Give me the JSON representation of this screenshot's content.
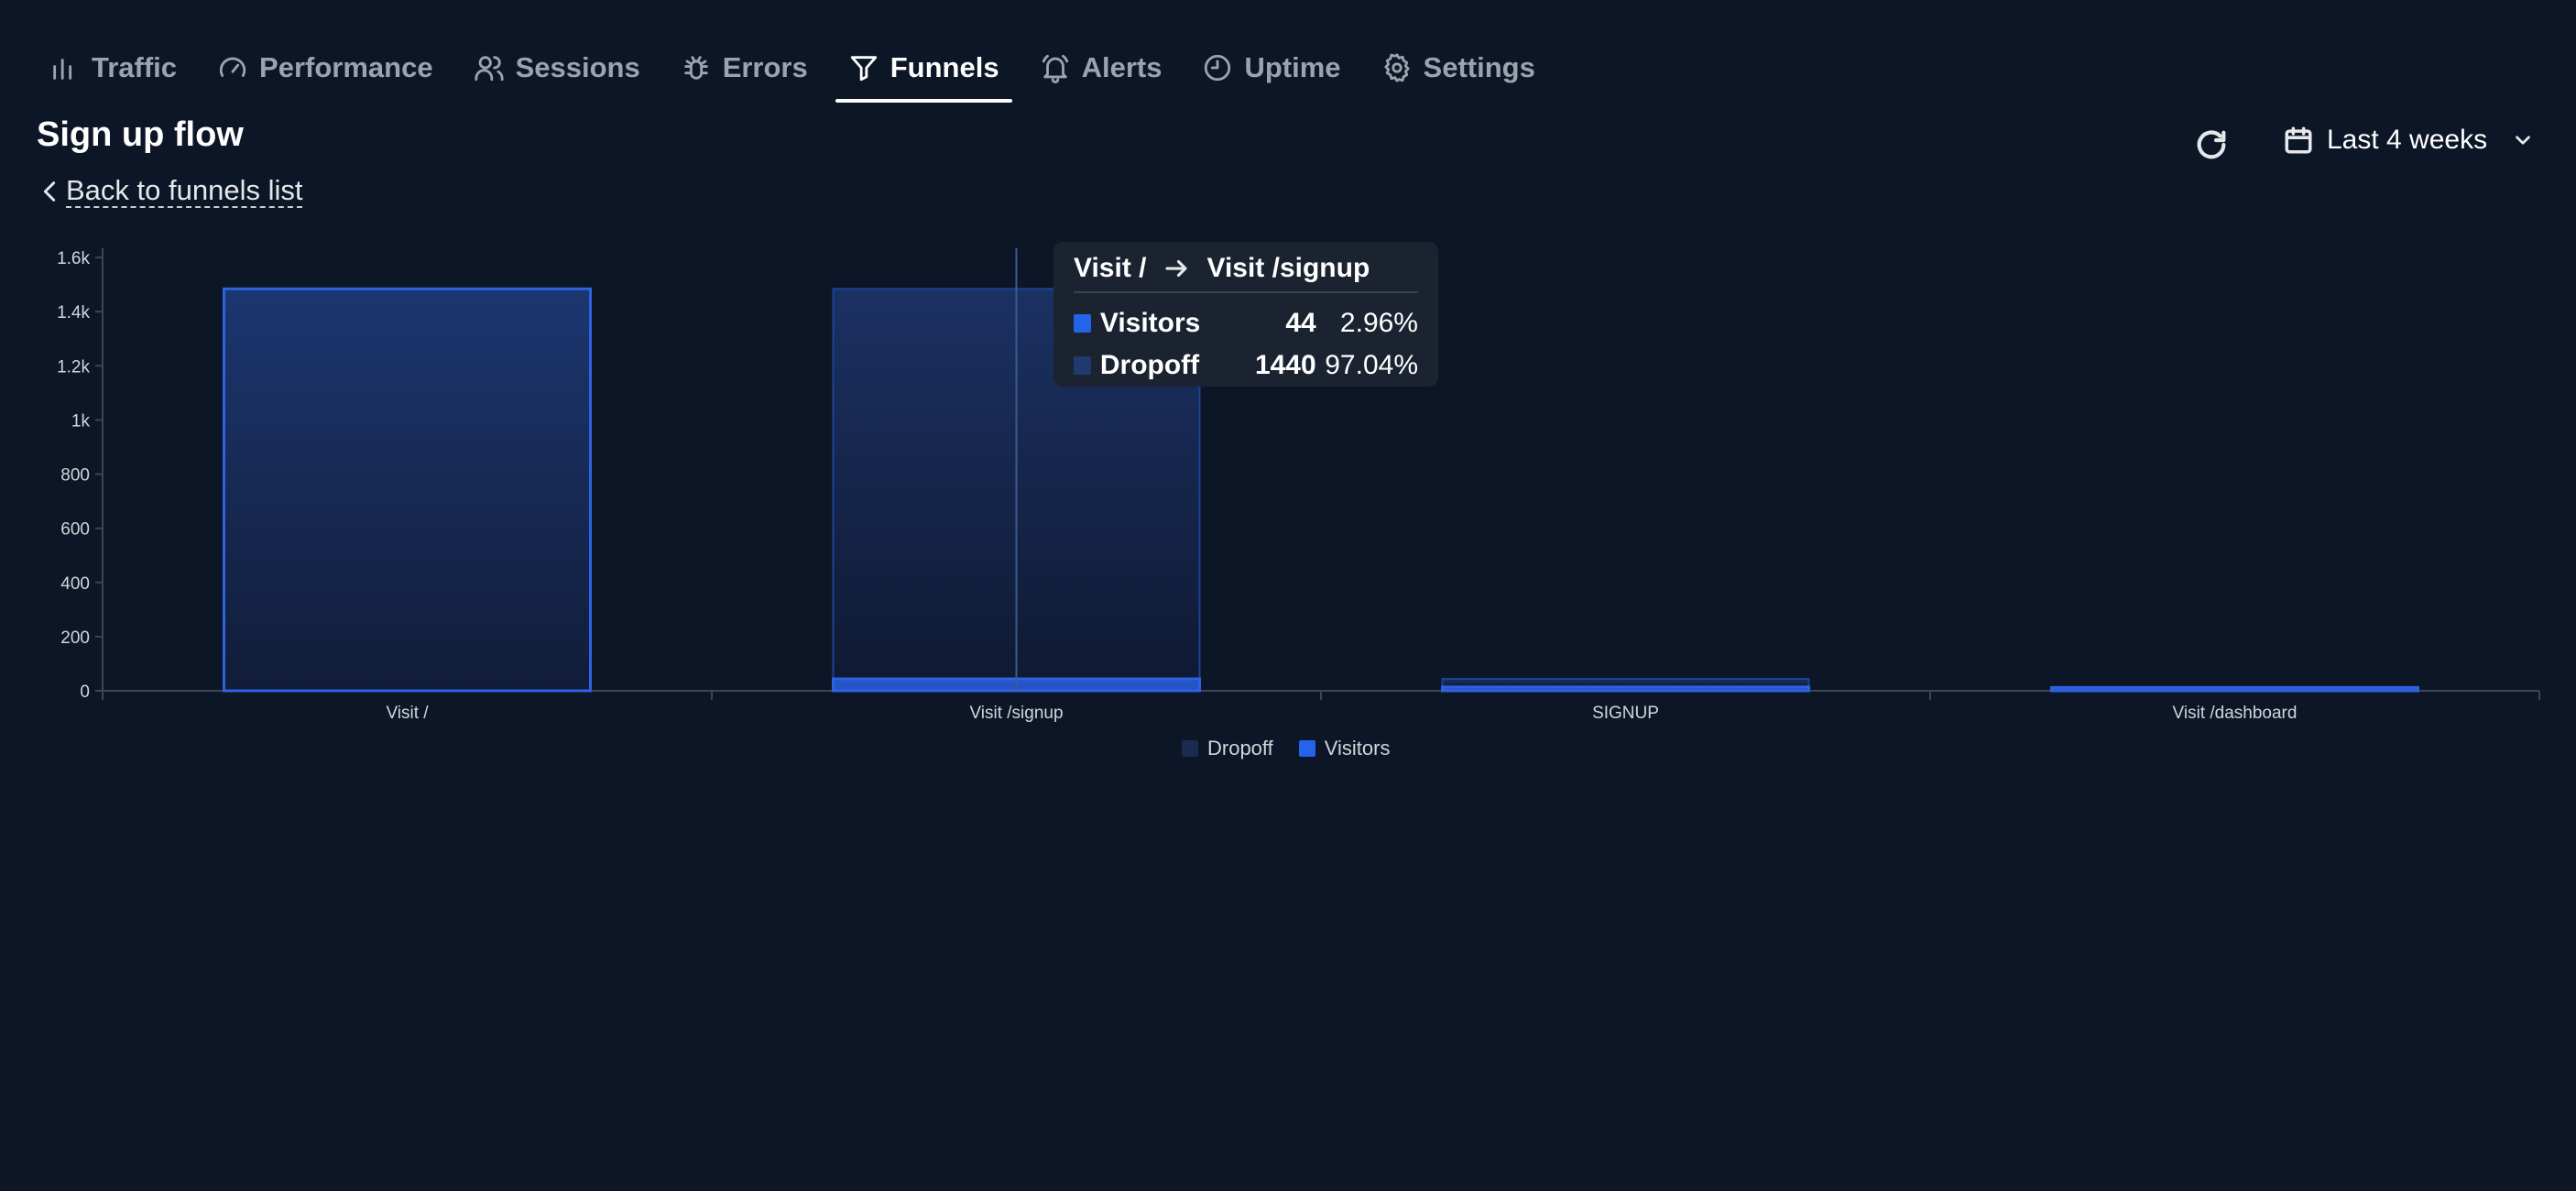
{
  "nav": {
    "items": [
      {
        "label": "Traffic",
        "icon": "bar-chart-icon"
      },
      {
        "label": "Performance",
        "icon": "gauge-icon"
      },
      {
        "label": "Sessions",
        "icon": "users-icon"
      },
      {
        "label": "Errors",
        "icon": "bug-icon"
      },
      {
        "label": "Funnels",
        "icon": "filter-icon",
        "active": true
      },
      {
        "label": "Alerts",
        "icon": "bell-icon"
      },
      {
        "label": "Uptime",
        "icon": "clock-icon"
      },
      {
        "label": "Settings",
        "icon": "gear-icon"
      }
    ]
  },
  "page": {
    "title": "Sign up flow",
    "back_label": "Back to funnels list"
  },
  "toolbar": {
    "range_label": "Last 4 weeks",
    "refresh_icon": "refresh-icon",
    "calendar_icon": "calendar-icon"
  },
  "tooltip": {
    "from": "Visit /",
    "to": "Visit /signup",
    "rows": [
      {
        "name": "Visitors",
        "count": "44",
        "pct": "2.96%",
        "color": "#2563eb"
      },
      {
        "name": "Dropoff",
        "count": "1440",
        "pct": "97.04%",
        "color": "#1e3a6e"
      }
    ]
  },
  "legend": {
    "items": [
      {
        "label": "Dropoff",
        "color": "#1a2c52"
      },
      {
        "label": "Visitors",
        "color": "#2563eb"
      }
    ]
  },
  "chart_data": {
    "type": "bar",
    "stacked": true,
    "categories": [
      "Visit /",
      "Visit /signup",
      "SIGNUP",
      "Visit /dashboard"
    ],
    "series": [
      {
        "name": "Visitors",
        "values": [
          1484,
          44,
          14,
          12
        ],
        "color": "#2563eb"
      },
      {
        "name": "Dropoff",
        "values": [
          0,
          1440,
          30,
          2
        ],
        "color": "#1a2c52"
      }
    ],
    "yticks": [
      "0",
      "200",
      "400",
      "600",
      "800",
      "1k",
      "1.2k",
      "1.4k",
      "1.6k"
    ],
    "ylim": [
      0,
      1600
    ],
    "legend_position": "bottom"
  }
}
